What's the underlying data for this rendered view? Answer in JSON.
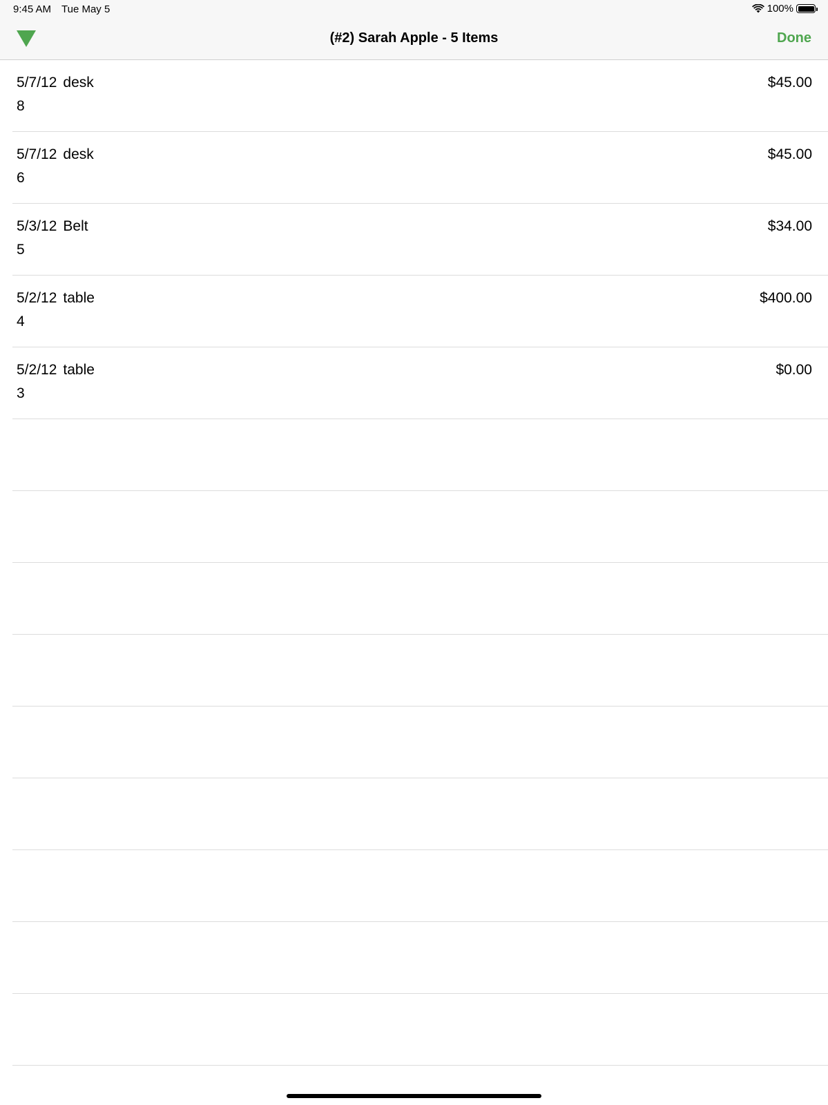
{
  "status_bar": {
    "time": "9:45 AM",
    "date": "Tue May 5",
    "battery": "100%",
    "battery_level": 1.0
  },
  "nav": {
    "title": "(#2) Sarah Apple - 5 Items",
    "done_label": "Done",
    "left_icon": "triangle-down-icon",
    "accent_color": "#4fa64f"
  },
  "items": [
    {
      "date": "5/7/12",
      "name": "desk",
      "number": "8",
      "price": "$45.00"
    },
    {
      "date": "5/7/12",
      "name": "desk",
      "number": "6",
      "price": "$45.00"
    },
    {
      "date": "5/3/12",
      "name": "Belt",
      "number": "5",
      "price": "$34.00"
    },
    {
      "date": "5/2/12",
      "name": "table",
      "number": "4",
      "price": "$400.00"
    },
    {
      "date": "5/2/12",
      "name": "table",
      "number": "3",
      "price": "$0.00"
    }
  ]
}
